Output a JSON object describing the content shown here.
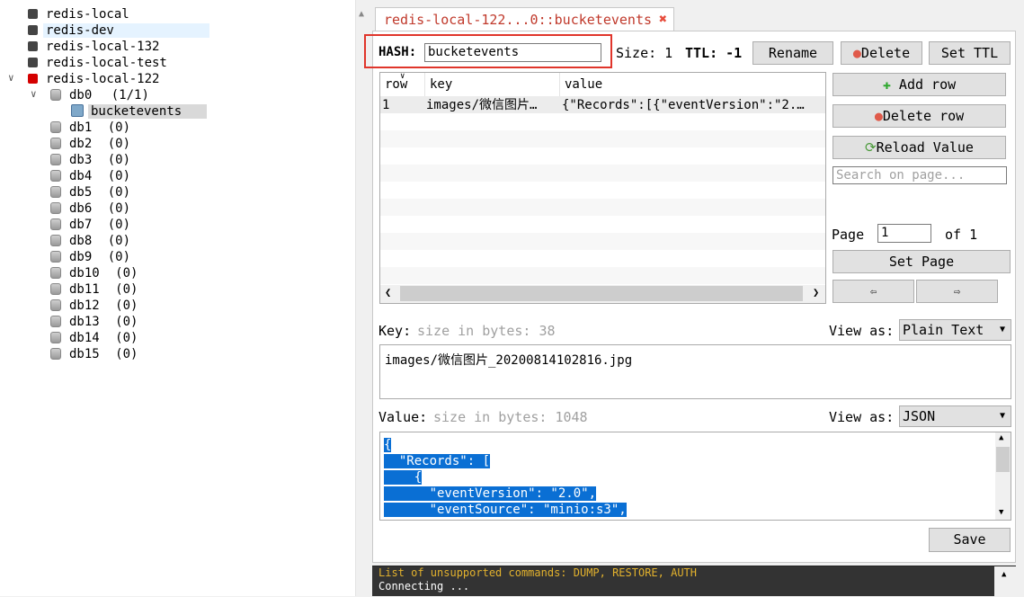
{
  "tree": {
    "connections": [
      "redis-local",
      "redis-dev",
      "redis-local-132",
      "redis-local-test",
      "redis-local-122"
    ],
    "databases": [
      {
        "name": "db0",
        "count": "(1/1)"
      },
      {
        "name": "db1",
        "count": "(0)"
      },
      {
        "name": "db2",
        "count": "(0)"
      },
      {
        "name": "db3",
        "count": "(0)"
      },
      {
        "name": "db4",
        "count": "(0)"
      },
      {
        "name": "db5",
        "count": "(0)"
      },
      {
        "name": "db6",
        "count": "(0)"
      },
      {
        "name": "db7",
        "count": "(0)"
      },
      {
        "name": "db8",
        "count": "(0)"
      },
      {
        "name": "db9",
        "count": "(0)"
      },
      {
        "name": "db10",
        "count": "(0)"
      },
      {
        "name": "db11",
        "count": "(0)"
      },
      {
        "name": "db12",
        "count": "(0)"
      },
      {
        "name": "db13",
        "count": "(0)"
      },
      {
        "name": "db14",
        "count": "(0)"
      },
      {
        "name": "db15",
        "count": "(0)"
      }
    ],
    "selected_key": "bucketevents"
  },
  "tab": {
    "title": "redis-local-122...0::bucketevents",
    "close": "✖"
  },
  "key_header": {
    "type_label": "HASH:",
    "key_name": "bucketevents",
    "size_label": "Size: 1",
    "ttl_label": "TTL: -1",
    "rename": "Rename",
    "delete": "Delete",
    "set_ttl": "Set TTL"
  },
  "table": {
    "columns": [
      "row",
      "key",
      "value"
    ],
    "rows": [
      {
        "row": "1",
        "key": "images/微信图片…",
        "value": "{\"Records\":[{\"eventVersion\":\"2.…"
      }
    ]
  },
  "side": {
    "add_row": "Add row",
    "delete_row": "Delete row",
    "reload": "Reload Value",
    "search_placeholder": "Search on page...",
    "page_label": "Page",
    "page_value": "1",
    "of_label": "of 1",
    "set_page": "Set Page",
    "prev": "⇦",
    "next": "⇨"
  },
  "key_section": {
    "label": "Key:",
    "size_hint": "size in bytes: 38",
    "view_as": "View as:",
    "format": "Plain Text",
    "value": "images/微信图片_20200814102816.jpg"
  },
  "value_section": {
    "label": "Value:",
    "size_hint": "size in bytes: 1048",
    "view_as": "View as:",
    "format": "JSON",
    "lines": [
      "{",
      "  \"Records\": [",
      "    {",
      "      \"eventVersion\": \"2.0\",",
      "      \"eventSource\": \"minio:s3\","
    ]
  },
  "save": "Save",
  "console": {
    "line1": "List of unsupported commands: DUMP, RESTORE, AUTH",
    "line2": "Connecting ..."
  },
  "colors": {
    "accent": "#0a6fd4",
    "tab_text": "#c0392b",
    "highlight_box": "#e0352b"
  }
}
